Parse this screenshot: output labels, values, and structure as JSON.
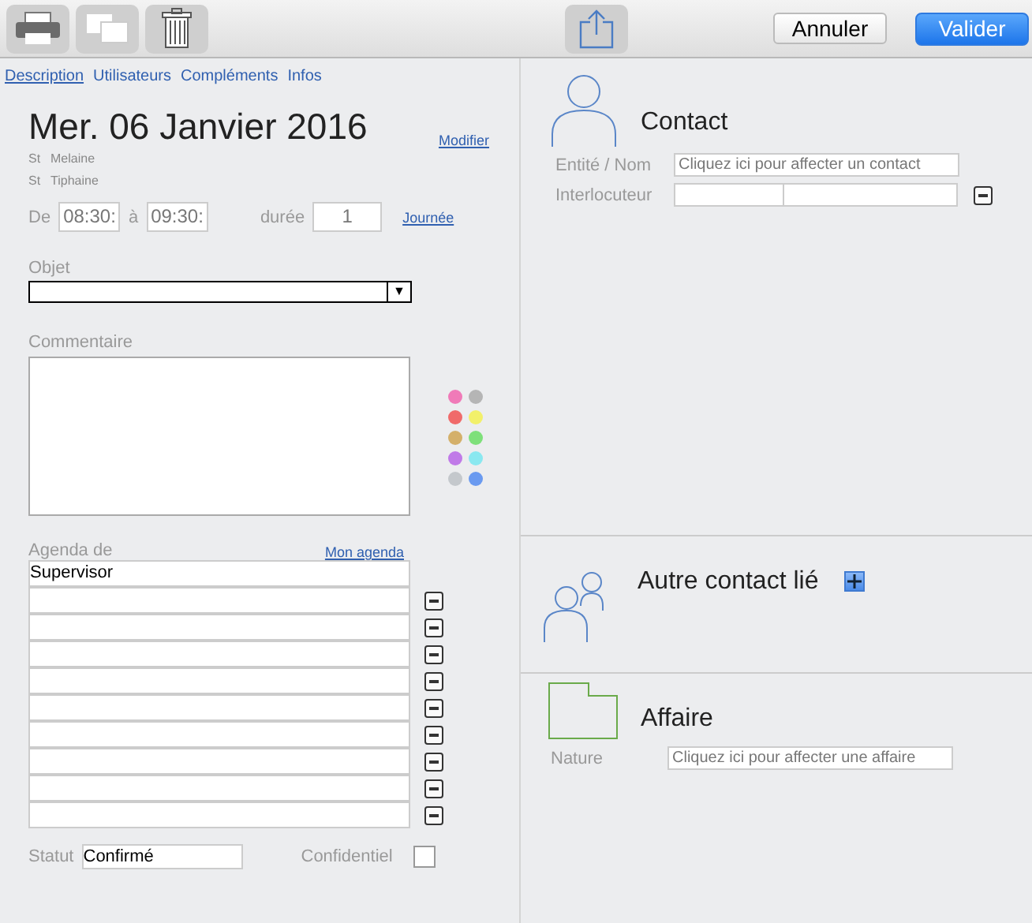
{
  "toolbar": {
    "cancel": "Annuler",
    "confirm": "Valider"
  },
  "tabs": [
    {
      "label": "Description",
      "selected": true
    },
    {
      "label": "Utilisateurs",
      "selected": false
    },
    {
      "label": "Compléments",
      "selected": false
    },
    {
      "label": "Infos",
      "selected": false
    }
  ],
  "date": {
    "title": "Mer. 06 Janvier 2016",
    "link": "Modifier",
    "saints": [
      {
        "prefix": "St",
        "name": "Melaine"
      },
      {
        "prefix": "St",
        "name": "Tiphaine"
      }
    ]
  },
  "time": {
    "from_label": "De",
    "from": "08:30:",
    "to_label": "à",
    "to": "09:30:",
    "duration_label": "durée",
    "duration": "1",
    "link": "Journée"
  },
  "objet": {
    "label": "Objet",
    "arrow": "▼"
  },
  "commentaire": {
    "label": "Commentaire"
  },
  "colors": [
    {
      "color": "#f07ab8"
    },
    {
      "color": "#b5b5b5"
    },
    {
      "color": "#f06a6a"
    },
    {
      "color": "#f2f06a"
    },
    {
      "color": "#d4b06a"
    },
    {
      "color": "#7ee07a"
    },
    {
      "color": "#c07ae8"
    },
    {
      "color": "#8ae8f0"
    },
    {
      "color": "#c4c8cc"
    },
    {
      "color": "#6a9af0"
    }
  ],
  "agenda": {
    "label": "Agenda de",
    "link": "Mon agenda",
    "rows": [
      {
        "value": "Supervisor",
        "removable": false
      },
      {
        "removable": true
      },
      {
        "removable": true
      },
      {
        "removable": true
      },
      {
        "removable": true
      },
      {
        "removable": true
      },
      {
        "removable": true
      },
      {
        "removable": true
      },
      {
        "removable": true
      },
      {
        "removable": true
      }
    ]
  },
  "statut": {
    "label": "Statut",
    "value": "Confirmé",
    "confidential_label": "Confidentiel",
    "confidential": false
  },
  "contact": {
    "title": "Contact",
    "entity_label": "Entité / Nom",
    "entity_placeholder": "Cliquez ici pour affecter un contact",
    "interlocutor_label": "Interlocuteur"
  },
  "other_contact": {
    "title": "Autre contact lié"
  },
  "affaire": {
    "title": "Affaire",
    "nature_label": "Nature",
    "nature_placeholder": "Cliquez ici pour affecter une affaire"
  }
}
